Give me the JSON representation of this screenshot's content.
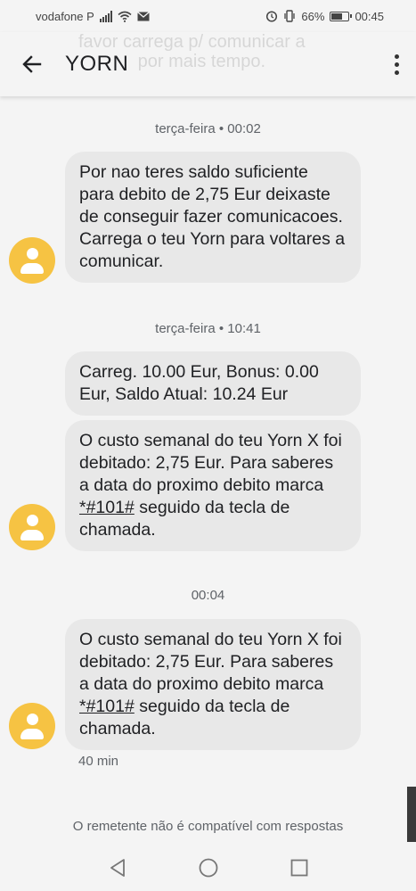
{
  "status_bar": {
    "carrier": "vodafone P",
    "battery_percent": "66%",
    "time": "00:45",
    "battery_level": 0.66
  },
  "header": {
    "title": "YORN",
    "ghost_text": "favor carrega p/ comunicar a\n            por mais tempo."
  },
  "conversation": {
    "timestamps": [
      "terça-feira • 00:02",
      "terça-feira • 10:41",
      "00:04"
    ],
    "messages": [
      {
        "text": "Por nao teres saldo suficiente para debito de 2,75 Eur deixaste de conseguir fazer comunicacoes. Carrega o teu Yorn para voltares a comunicar."
      },
      {
        "text": "Carreg. 10.00 Eur, Bonus: 0.00 Eur, Saldo Atual: 10.24 Eur"
      },
      {
        "text_before": "O custo semanal do teu Yorn X foi debitado: 2,75 Eur. Para saberes a data do proximo debito marca ",
        "code": "*#101#",
        "text_after": " seguido da tecla de chamada."
      },
      {
        "text_before": "O custo semanal do teu Yorn X foi debitado: 2,75 Eur. Para saberes a data do proximo debito marca ",
        "code": "*#101#",
        "text_after": " seguido da tecla de chamada."
      }
    ],
    "last_age": "40 min",
    "footer_note": "O remetente não é compatível com respostas"
  },
  "icons": {
    "back": "arrow-left-icon",
    "more": "more-vert-icon",
    "avatar": "person-icon",
    "nav": [
      "triangle-back-icon",
      "circle-home-icon",
      "square-recents-icon"
    ]
  },
  "colors": {
    "avatar": "#f6c343",
    "bubble": "#e8e8e8",
    "background": "#f4f4f4"
  }
}
